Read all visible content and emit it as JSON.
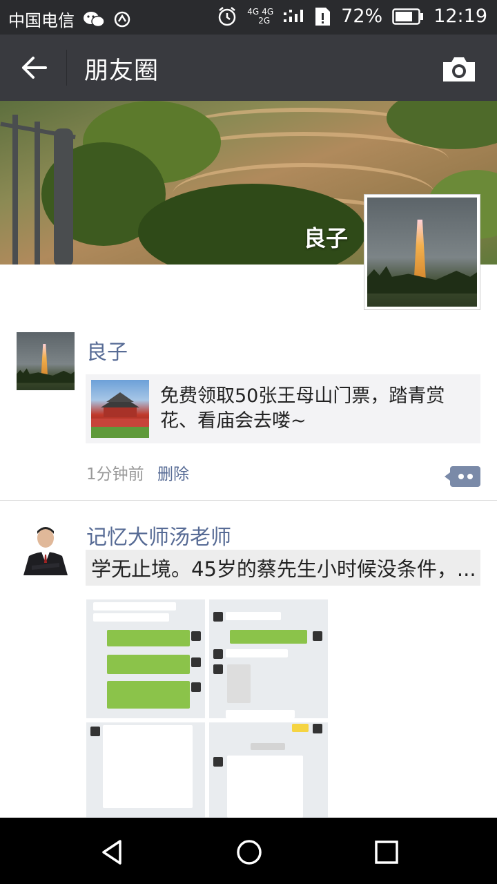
{
  "status_bar": {
    "carrier": "中国电信",
    "network_top": "4G",
    "network_mid": "4G",
    "network_bottom": "2G",
    "battery": "72%",
    "time": "12:19"
  },
  "header": {
    "title": "朋友圈"
  },
  "cover": {
    "name": "良子"
  },
  "posts": [
    {
      "name": "良子",
      "share_text": "免费领取50张王母山门票，踏青赏花、看庙会去喽~",
      "time": "1分钟前",
      "delete_label": "删除"
    },
    {
      "name": "记忆大师汤老师",
      "text": "学无止境。45岁的蔡先生小时候没条件，..."
    }
  ],
  "icons": {
    "back": "arrow-left-icon",
    "camera": "camera-icon",
    "comment": "comment-icon",
    "nav_back": "triangle-back-icon",
    "nav_home": "circle-home-icon",
    "nav_recent": "square-recent-icon"
  },
  "colors": {
    "topbar": "#393a3f",
    "link": "#576b95",
    "status_bar": "#2a2b2e"
  }
}
